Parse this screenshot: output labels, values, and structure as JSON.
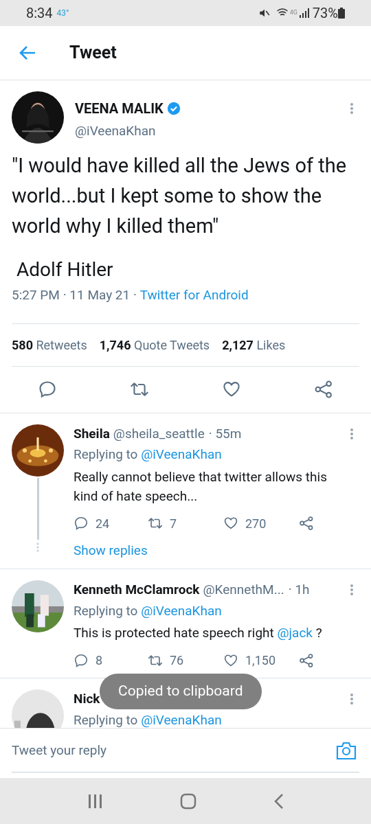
{
  "status_bar": {
    "time": "8:34",
    "temperature": "43°",
    "network": "4G",
    "battery": "73%"
  },
  "header": {
    "title": "Tweet"
  },
  "tweet": {
    "name": "VEENA MALIK",
    "verified": true,
    "handle": "@iVeenaKhan",
    "text": "\"I would have killed all the Jews of the world...but I kept some to show the world why I killed them\"",
    "attribution": "Adolf Hitler",
    "time": "5:27 PM · 11 May 21 · ",
    "source": "Twitter for Android",
    "stats": [
      {
        "count": "580",
        "label": "Retweets"
      },
      {
        "count": "1,746",
        "label": "Quote Tweets"
      },
      {
        "count": "2,127",
        "label": "Likes"
      }
    ]
  },
  "replies": [
    {
      "name": "Sheila",
      "handle": "@sheila_seattle",
      "time": "· 55m",
      "replying_to": "Replying to",
      "mention": "@iVeenaKhan",
      "text": "Really cannot believe that twitter allows this kind of hate speech...",
      "replies_count": "24",
      "retweets": "7",
      "likes": "270",
      "show_replies": "Show replies",
      "thread": true
    },
    {
      "name": "Kenneth McClamrock",
      "handle": "@KennethM...",
      "time": "· 1h",
      "replying_to": "Replying to",
      "mention": "@iVeenaKhan",
      "text": "This is protected hate speech right ",
      "text_mention": "@jack",
      "text_after": " ?",
      "replies_count": "8",
      "retweets": "76",
      "likes": "1,150",
      "thread": false
    },
    {
      "name": "Nick",
      "replying_to": "Replying to",
      "mention": "@iVeenaKhan",
      "thread": false
    }
  ],
  "toast": "Copied to clipboard",
  "reply_bar": {
    "placeholder": "Tweet your reply"
  }
}
